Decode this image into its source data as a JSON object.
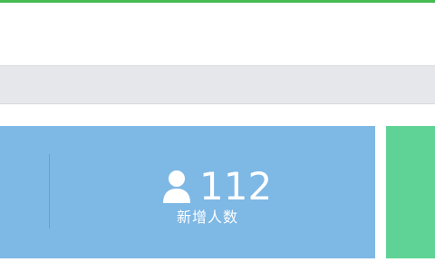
{
  "stat_card": {
    "value": "112",
    "label": "新增人数",
    "icon": "user-icon"
  },
  "colors": {
    "top_accent": "#45bb52",
    "card_blue": "#7eb8e5",
    "card_green": "#5fd396",
    "gray_bar": "#e6e7eb"
  }
}
